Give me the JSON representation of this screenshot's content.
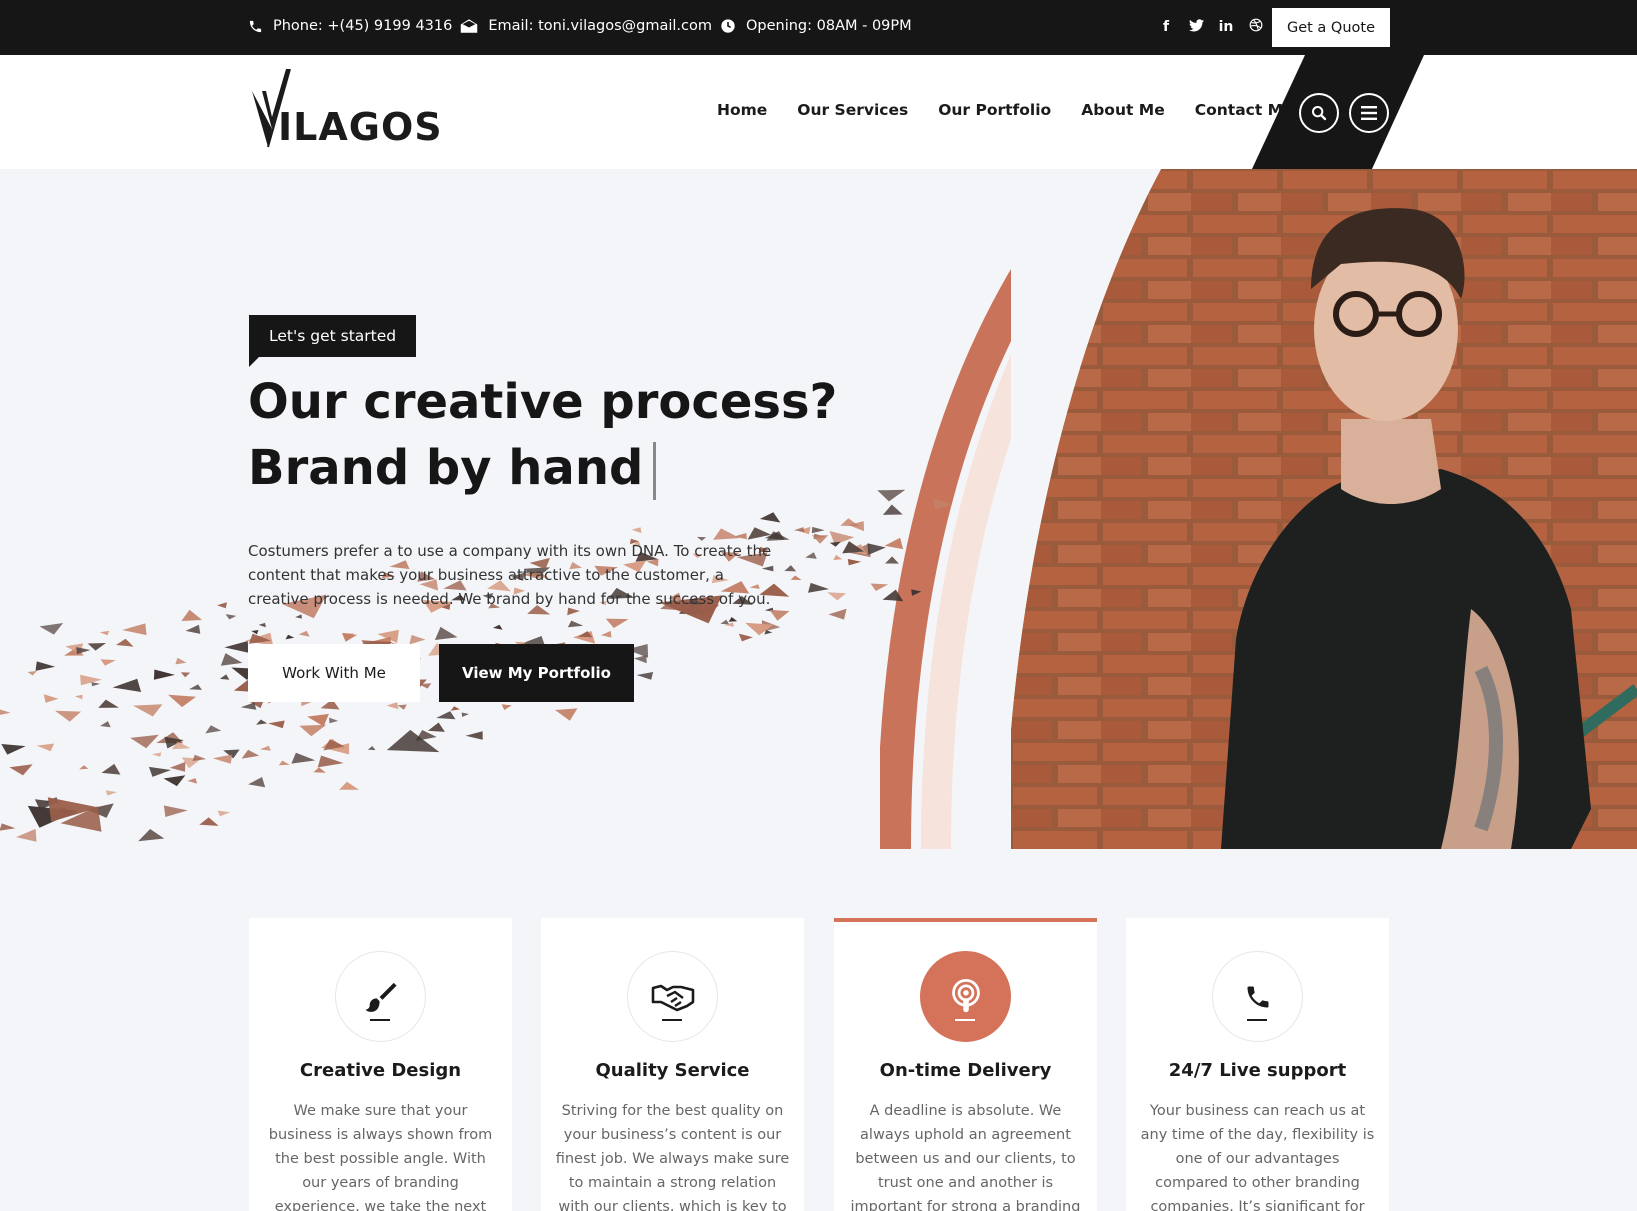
{
  "topbar": {
    "phone": "Phone: +(45) 9199 4316",
    "email": "Email: toni.vilagos@gmail.com",
    "opening": "Opening: 08AM - 09PM",
    "social_icons": [
      "facebook-icon",
      "twitter-icon",
      "linkedin-icon",
      "dribbble-icon"
    ],
    "quote_label": "Get a Quote"
  },
  "header": {
    "logo_text": "ILAGOS",
    "nav": [
      "Home",
      "Our Services",
      "Our Portfolio",
      "About Me",
      "Contact Me"
    ]
  },
  "hero": {
    "badge": "Let's get started",
    "title_line1": "Our creative process?",
    "title_line2": "Brand by hand",
    "lead": "Costumers prefer a to use a company with its own DNA. To create the content that makes your business attractive to the customer, a creative process is needed. We brand by hand for the success of you.",
    "btn_work": "Work With Me",
    "btn_portfolio": "View My Portfolio"
  },
  "features": [
    {
      "title": "Creative Design",
      "icon": "paintbrush-icon",
      "text": "We make sure that your business is always shown from the best possible angle. With our years of branding experience, we take the next step together"
    },
    {
      "title": "Quality Service",
      "icon": "handshake-icon",
      "text": "Striving for the best quality on your business’s content is our finest job. We always make sure to maintain a strong relation with our clients, which is key to"
    },
    {
      "title": "On-time Delivery",
      "icon": "podcast-icon",
      "text": "A deadline is absolute. We always uphold an agreement between us and our clients, to trust one and another is important for strong a branding"
    },
    {
      "title": "24/7 Live support",
      "icon": "phone-icon",
      "text": "Your business can reach us at any time of the day, flexibility is one of our advantages compared to other branding companies. It’s significant for the"
    }
  ],
  "colors": {
    "accent": "#d4735a",
    "dark": "#161616",
    "arc_light": "#f6e3dc"
  }
}
